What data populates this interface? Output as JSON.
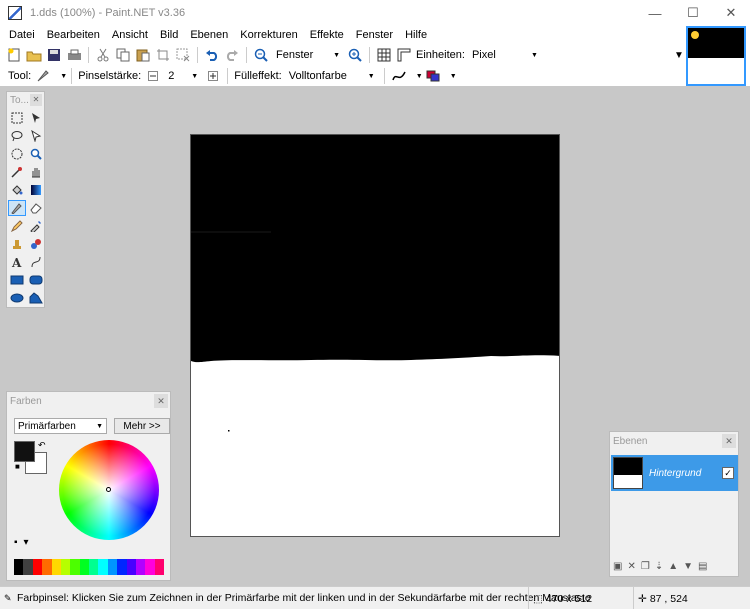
{
  "window": {
    "title": "1.dds (100%) - Paint.NET v3.36",
    "minimize": "—",
    "maximize": "☐",
    "close": "✕"
  },
  "menu": [
    "Datei",
    "Bearbeiten",
    "Ansicht",
    "Bild",
    "Ebenen",
    "Korrekturen",
    "Effekte",
    "Fenster",
    "Hilfe"
  ],
  "toolbar": {
    "zoom_value": "Fenster",
    "units_label": "Einheiten:",
    "units_value": "Pixel"
  },
  "tool_options": {
    "tool_label": "Tool:",
    "brush_width_label": "Pinselstärke:",
    "brush_width_value": "2",
    "fill_label": "Fülleffekt:",
    "fill_value": "Volltonfarbe"
  },
  "tools_panel": {
    "title": "To...",
    "close": "✕"
  },
  "colors_panel": {
    "title": "Farben",
    "close": "✕",
    "mode": "Primärfarben",
    "more_button": "Mehr >>",
    "primary_color": "#111111",
    "secondary_color": "#ffffff",
    "palette": [
      "#000000",
      "#404040",
      "#ff0000",
      "#ff6a00",
      "#ffd800",
      "#b6ff00",
      "#4cff00",
      "#00ff21",
      "#00ff90",
      "#00ffff",
      "#0094ff",
      "#0026ff",
      "#4800ff",
      "#b200ff",
      "#ff00dc",
      "#ff006e"
    ]
  },
  "layers_panel": {
    "title": "Ebenen",
    "close": "✕",
    "layer_name": "Hintergrund",
    "layer_visible": true
  },
  "status": {
    "tool_hint": "Farbpinsel: Klicken Sie zum Zeichnen in der Primärfarbe mit der linken und in der Sekundärfarbe mit der rechten Maustaste",
    "image_size": "470 x 512",
    "cursor_position": "87 , 524"
  },
  "colors": {
    "workspace": "#c8c8c8",
    "selection_accent": "#3d9ae8"
  }
}
